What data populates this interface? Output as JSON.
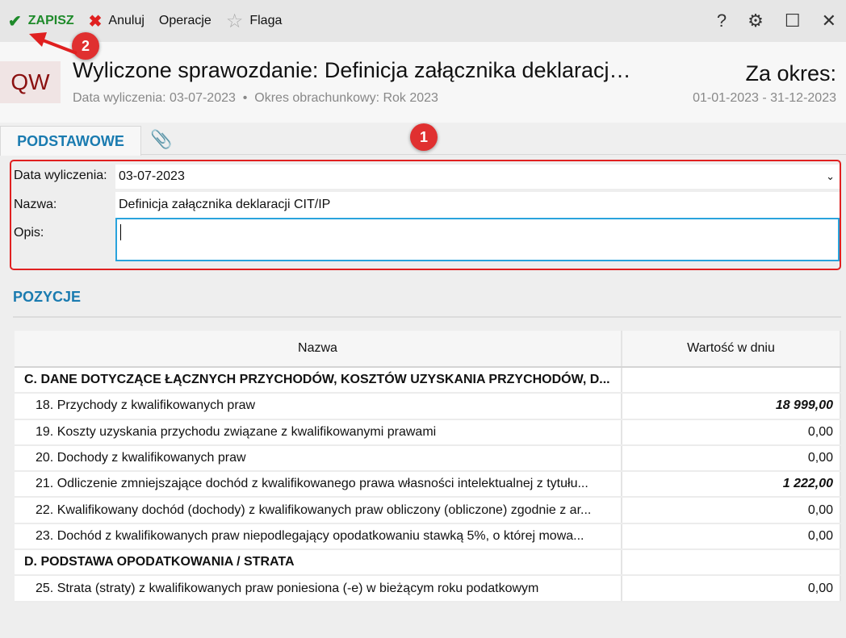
{
  "toolbar": {
    "save": "ZAPISZ",
    "cancel": "Anuluj",
    "operations": "Operacje",
    "flag": "Flaga",
    "help": "?",
    "settings": "⚙",
    "maximize": "☐",
    "close": "✕"
  },
  "header": {
    "logo": "QW",
    "title": "Wyliczone sprawozdanie: Definicja załącznika deklaracj…",
    "subtitle": "Data wyliczenia: 03-07-2023  •  Okres obrachunkowy: Rok 2023",
    "period_label": "Za okres:",
    "period": "01-01-2023 - 31-12-2023"
  },
  "tabs": {
    "main": "PODSTAWOWE"
  },
  "form": {
    "date_label": "Data wyliczenia:",
    "date_value": "03-07-2023",
    "name_label": "Nazwa:",
    "name_value": "Definicja załącznika deklaracji CIT/IP",
    "desc_label": "Opis:",
    "desc_value": ""
  },
  "positions": {
    "title": "POZYCJE",
    "col_name": "Nazwa",
    "col_value": "Wartość w dniu",
    "rows": [
      {
        "name": "C. DANE DOTYCZĄCE ŁĄCZNYCH PRZYCHODÓW, KOSZTÓW UZYSKANIA PRZYCHODÓW, D...",
        "value": ""
      },
      {
        "name": "18. Przychody z kwalifikowanych praw",
        "value": "18 999,00"
      },
      {
        "name": "19. Koszty uzyskania przychodu związane z kwalifikowanymi prawami",
        "value": "0,00"
      },
      {
        "name": "20. Dochody z kwalifikowanych praw",
        "value": "0,00"
      },
      {
        "name": "21. Odliczenie zmniejszające dochód z kwalifikowanego prawa własności intelektualnej z tytułu...",
        "value": "1 222,00"
      },
      {
        "name": "22. Kwalifikowany dochód (dochody) z kwalifikowanych praw obliczony (obliczone) zgodnie z ar...",
        "value": "0,00"
      },
      {
        "name": "23. Dochód z kwalifikowanych praw niepodlegający opodatkowaniu stawką 5%, o której mowa...",
        "value": "0,00"
      },
      {
        "name": "D. PODSTAWA OPODATKOWANIA / STRATA",
        "value": ""
      },
      {
        "name": "25. Strata (straty) z kwalifikowanych praw poniesiona (-e) w bieżącym roku podatkowym",
        "value": "0,00"
      }
    ]
  },
  "annotations": {
    "one": "1",
    "two": "2"
  }
}
